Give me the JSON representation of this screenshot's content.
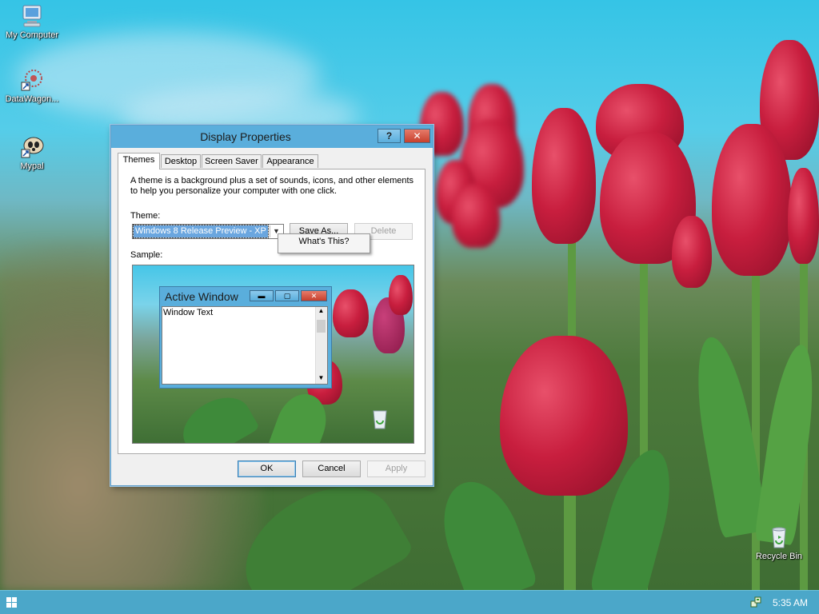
{
  "desktop": {
    "icons": [
      {
        "label": "My Computer",
        "icon": "computer-icon"
      },
      {
        "label": "DataWagon...",
        "icon": "shortcut-icon"
      },
      {
        "label": "Mypal",
        "icon": "browser-icon"
      },
      {
        "label": "Recycle Bin",
        "icon": "recycle-bin-icon"
      }
    ]
  },
  "dialog": {
    "title": "Display Properties",
    "help_label": "?",
    "close_label": "✕",
    "tabs": [
      "Themes",
      "Desktop",
      "Screen Saver",
      "Appearance"
    ],
    "active_tab": "Themes",
    "description": "A theme is a background plus a set of sounds, icons, and other elements to help you personalize your computer with one click.",
    "theme_label": "Theme:",
    "theme_value": "Windows 8 Release Preview - XP",
    "save_as_label": "Save As...",
    "delete_label": "Delete",
    "context_menu_item": "What's This?",
    "sample_label": "Sample:",
    "sample_window": {
      "title": "Active Window",
      "text": "Window Text"
    },
    "ok_label": "OK",
    "cancel_label": "Cancel",
    "apply_label": "Apply"
  },
  "taskbar": {
    "clock": "5:35 AM"
  },
  "colors": {
    "title_bar": "#5aaedc",
    "close_button": "#c7402d",
    "taskbar": "#4ba7c9",
    "selection": "#6aa6df"
  }
}
